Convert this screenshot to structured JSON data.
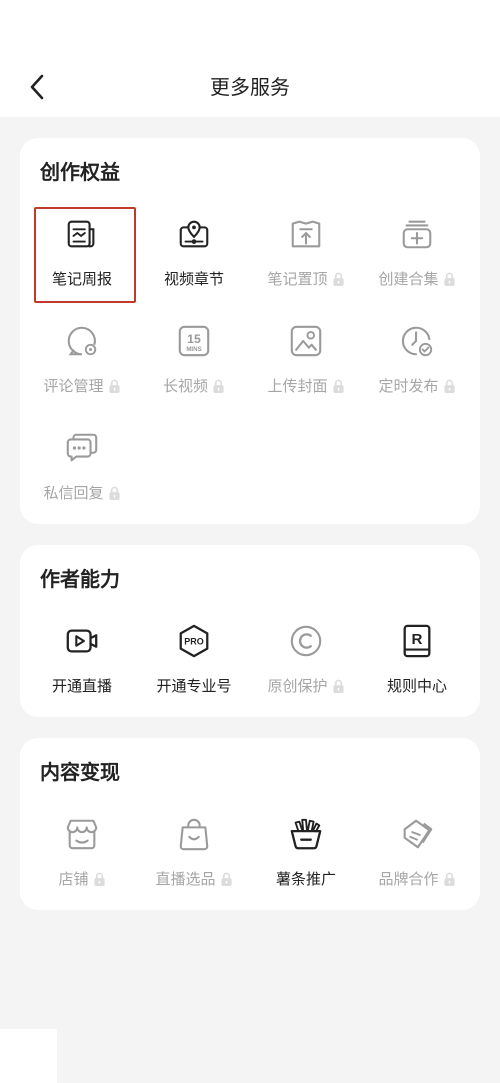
{
  "header": {
    "title": "更多服务",
    "back_icon": "chevron-left-icon"
  },
  "sections": [
    {
      "id": "creation-rights",
      "title": "创作权益",
      "items": [
        {
          "label": "笔记周报",
          "icon": "note-report-icon",
          "locked": false,
          "selected": true
        },
        {
          "label": "视频章节",
          "icon": "video-chapter-icon",
          "locked": false,
          "selected": false
        },
        {
          "label": "笔记置顶",
          "icon": "pin-top-icon",
          "locked": true,
          "selected": false
        },
        {
          "label": "创建合集",
          "icon": "collection-add-icon",
          "locked": true,
          "selected": false
        },
        {
          "label": "评论管理",
          "icon": "comment-manage-icon",
          "locked": true,
          "selected": false
        },
        {
          "label": "长视频",
          "icon": "long-video-15mins-icon",
          "locked": true,
          "selected": false,
          "icon_text": [
            "15",
            "MINS"
          ]
        },
        {
          "label": "上传封面",
          "icon": "upload-cover-icon",
          "locked": true,
          "selected": false
        },
        {
          "label": "定时发布",
          "icon": "scheduled-publish-icon",
          "locked": true,
          "selected": false
        },
        {
          "label": "私信回复",
          "icon": "message-reply-icon",
          "locked": true,
          "selected": false
        }
      ]
    },
    {
      "id": "author-abilities",
      "title": "作者能力",
      "items": [
        {
          "label": "开通直播",
          "icon": "live-camera-icon",
          "locked": false,
          "selected": false
        },
        {
          "label": "开通专业号",
          "icon": "pro-badge-icon",
          "locked": false,
          "selected": false,
          "icon_text": [
            "PRO"
          ]
        },
        {
          "label": "原创保护",
          "icon": "copyright-icon",
          "locked": true,
          "selected": false
        },
        {
          "label": "规则中心",
          "icon": "rules-book-icon",
          "locked": false,
          "selected": false,
          "icon_text": [
            "R"
          ]
        }
      ]
    },
    {
      "id": "monetization",
      "title": "内容变现",
      "items": [
        {
          "label": "店铺",
          "icon": "shop-icon",
          "locked": true,
          "selected": false
        },
        {
          "label": "直播选品",
          "icon": "shopping-bag-icon",
          "locked": true,
          "selected": false
        },
        {
          "label": "薯条推广",
          "icon": "fries-promo-icon",
          "locked": false,
          "selected": false
        },
        {
          "label": "品牌合作",
          "icon": "brand-cooperation-icon",
          "locked": true,
          "selected": false
        }
      ]
    }
  ],
  "colors": {
    "active_text": "#222222",
    "disabled_text": "#a6a6a6",
    "highlight": "#c0392b",
    "background": "#f4f4f4",
    "card": "#ffffff"
  }
}
